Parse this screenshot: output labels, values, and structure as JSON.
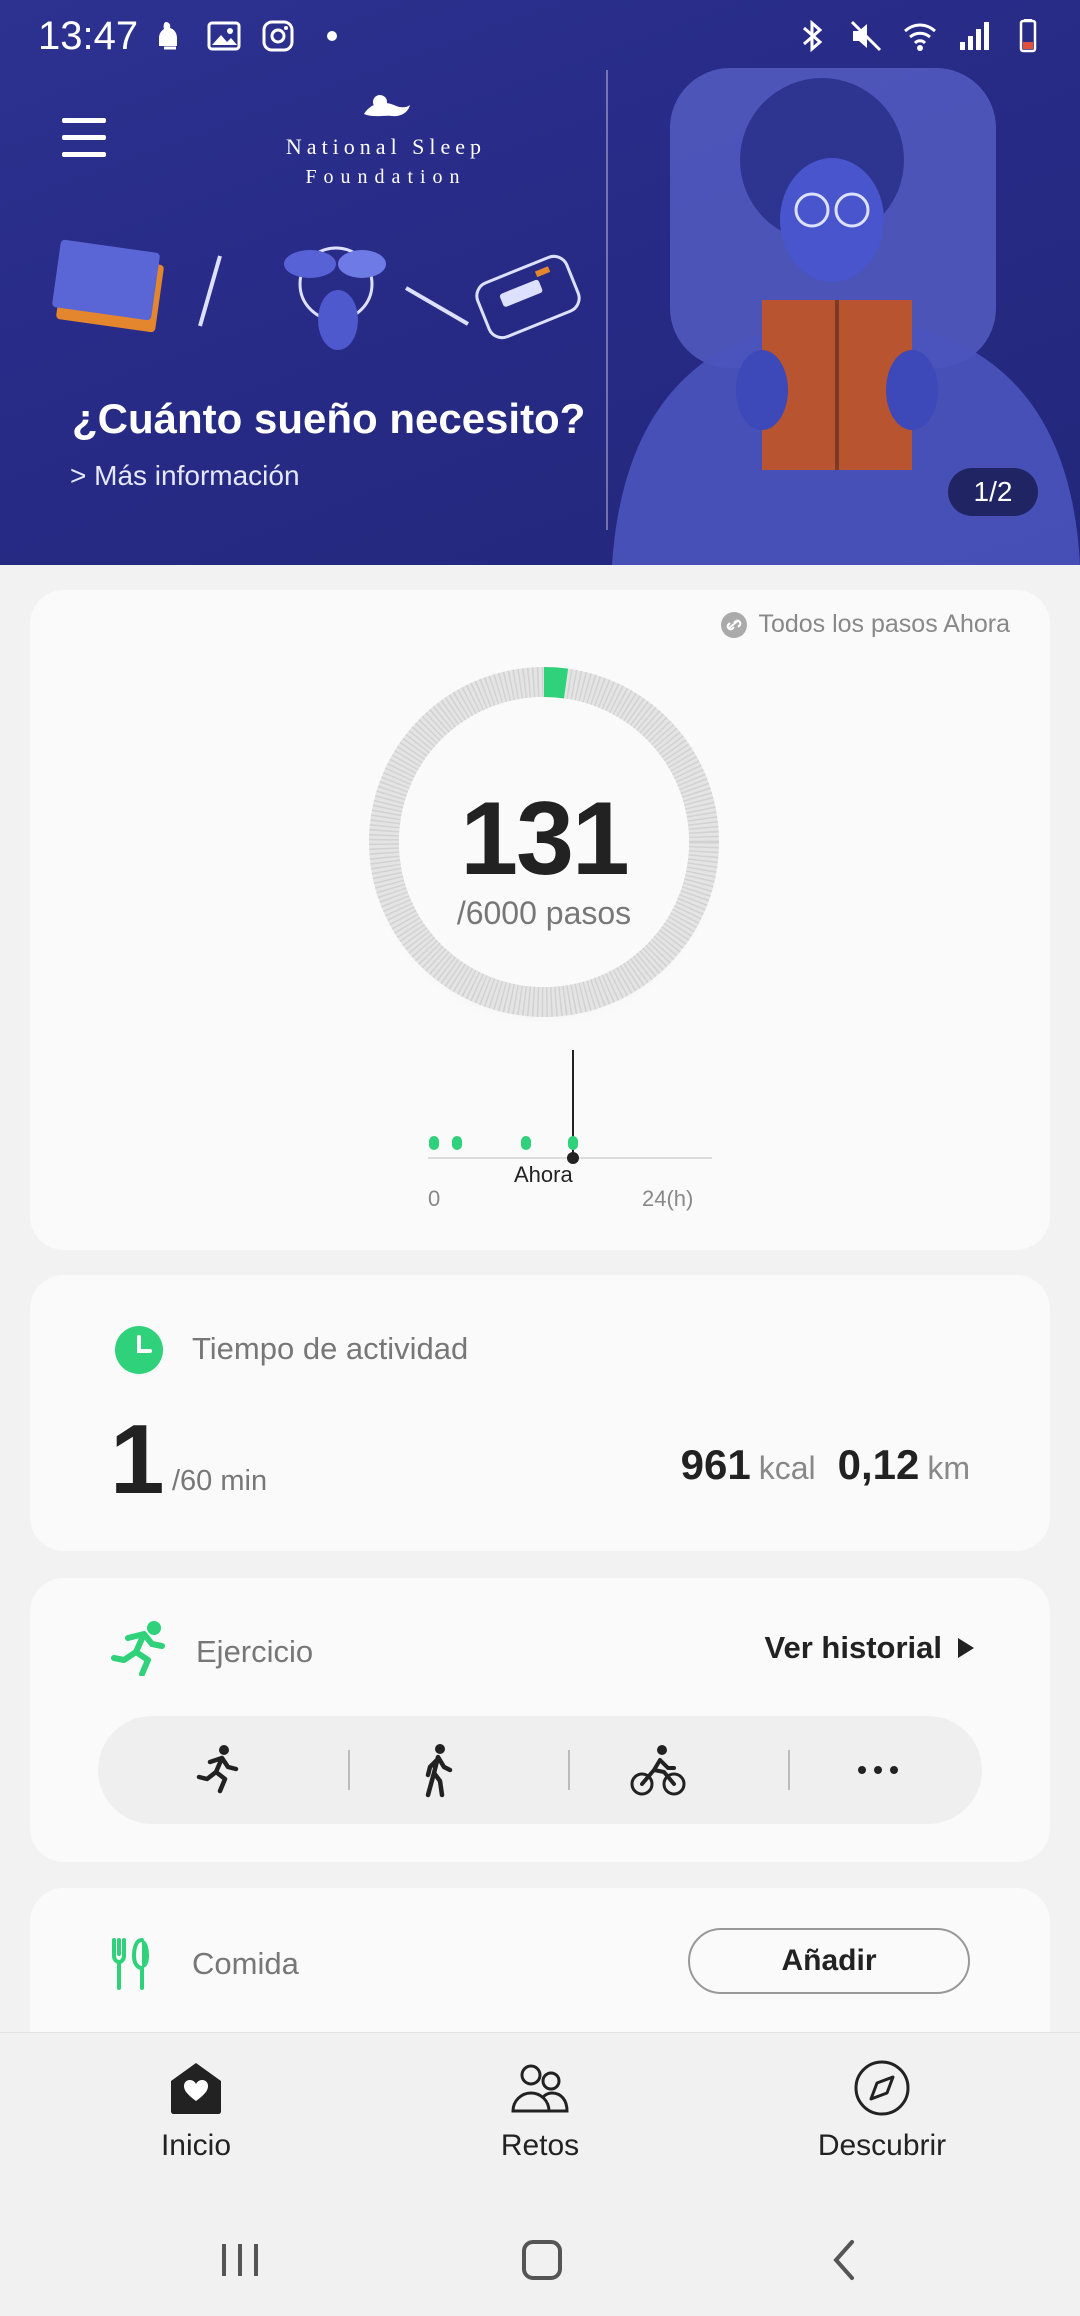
{
  "status_bar": {
    "time": "13:47",
    "left_icons": [
      "notification-icon",
      "gallery-icon",
      "instagram-icon",
      "dot-icon"
    ],
    "right_icons": [
      "bluetooth-icon",
      "mute-icon",
      "wifi-icon",
      "signal-icon",
      "battery-icon"
    ]
  },
  "banner": {
    "logo_line1": "National Sleep",
    "logo_line2": "Foundation",
    "title": "¿Cuánto sueño necesito?",
    "more_link": "> Más información",
    "pager": "1/2",
    "colors": {
      "background": "#2d3190",
      "illustration": "#4653c4"
    }
  },
  "steps_card": {
    "all_steps_link": "Todos los pasos Ahora",
    "count": "131",
    "goal": "/6000 pasos",
    "progress_fraction": 0.022,
    "timeline": {
      "now_label": "Ahora",
      "start_label": "0",
      "end_label": "24(h)"
    },
    "accent": "#2fd17a"
  },
  "activity_card": {
    "title": "Tiempo de actividad",
    "minutes": "1",
    "minutes_unit": "/60 min",
    "kcal_value": "961",
    "kcal_unit": "kcal",
    "km_value": "0,12",
    "km_unit": "km"
  },
  "exercise_card": {
    "title": "Ejercicio",
    "history_label": "Ver historial",
    "types": [
      "running-icon",
      "walking-icon",
      "cycling-icon",
      "more-icon"
    ]
  },
  "food_card": {
    "title": "Comida",
    "add_label": "Añadir"
  },
  "bottom_nav": {
    "items": [
      {
        "label": "Inicio",
        "icon": "home-icon"
      },
      {
        "label": "Retos",
        "icon": "people-icon"
      },
      {
        "label": "Descubrir",
        "icon": "compass-icon"
      }
    ]
  }
}
